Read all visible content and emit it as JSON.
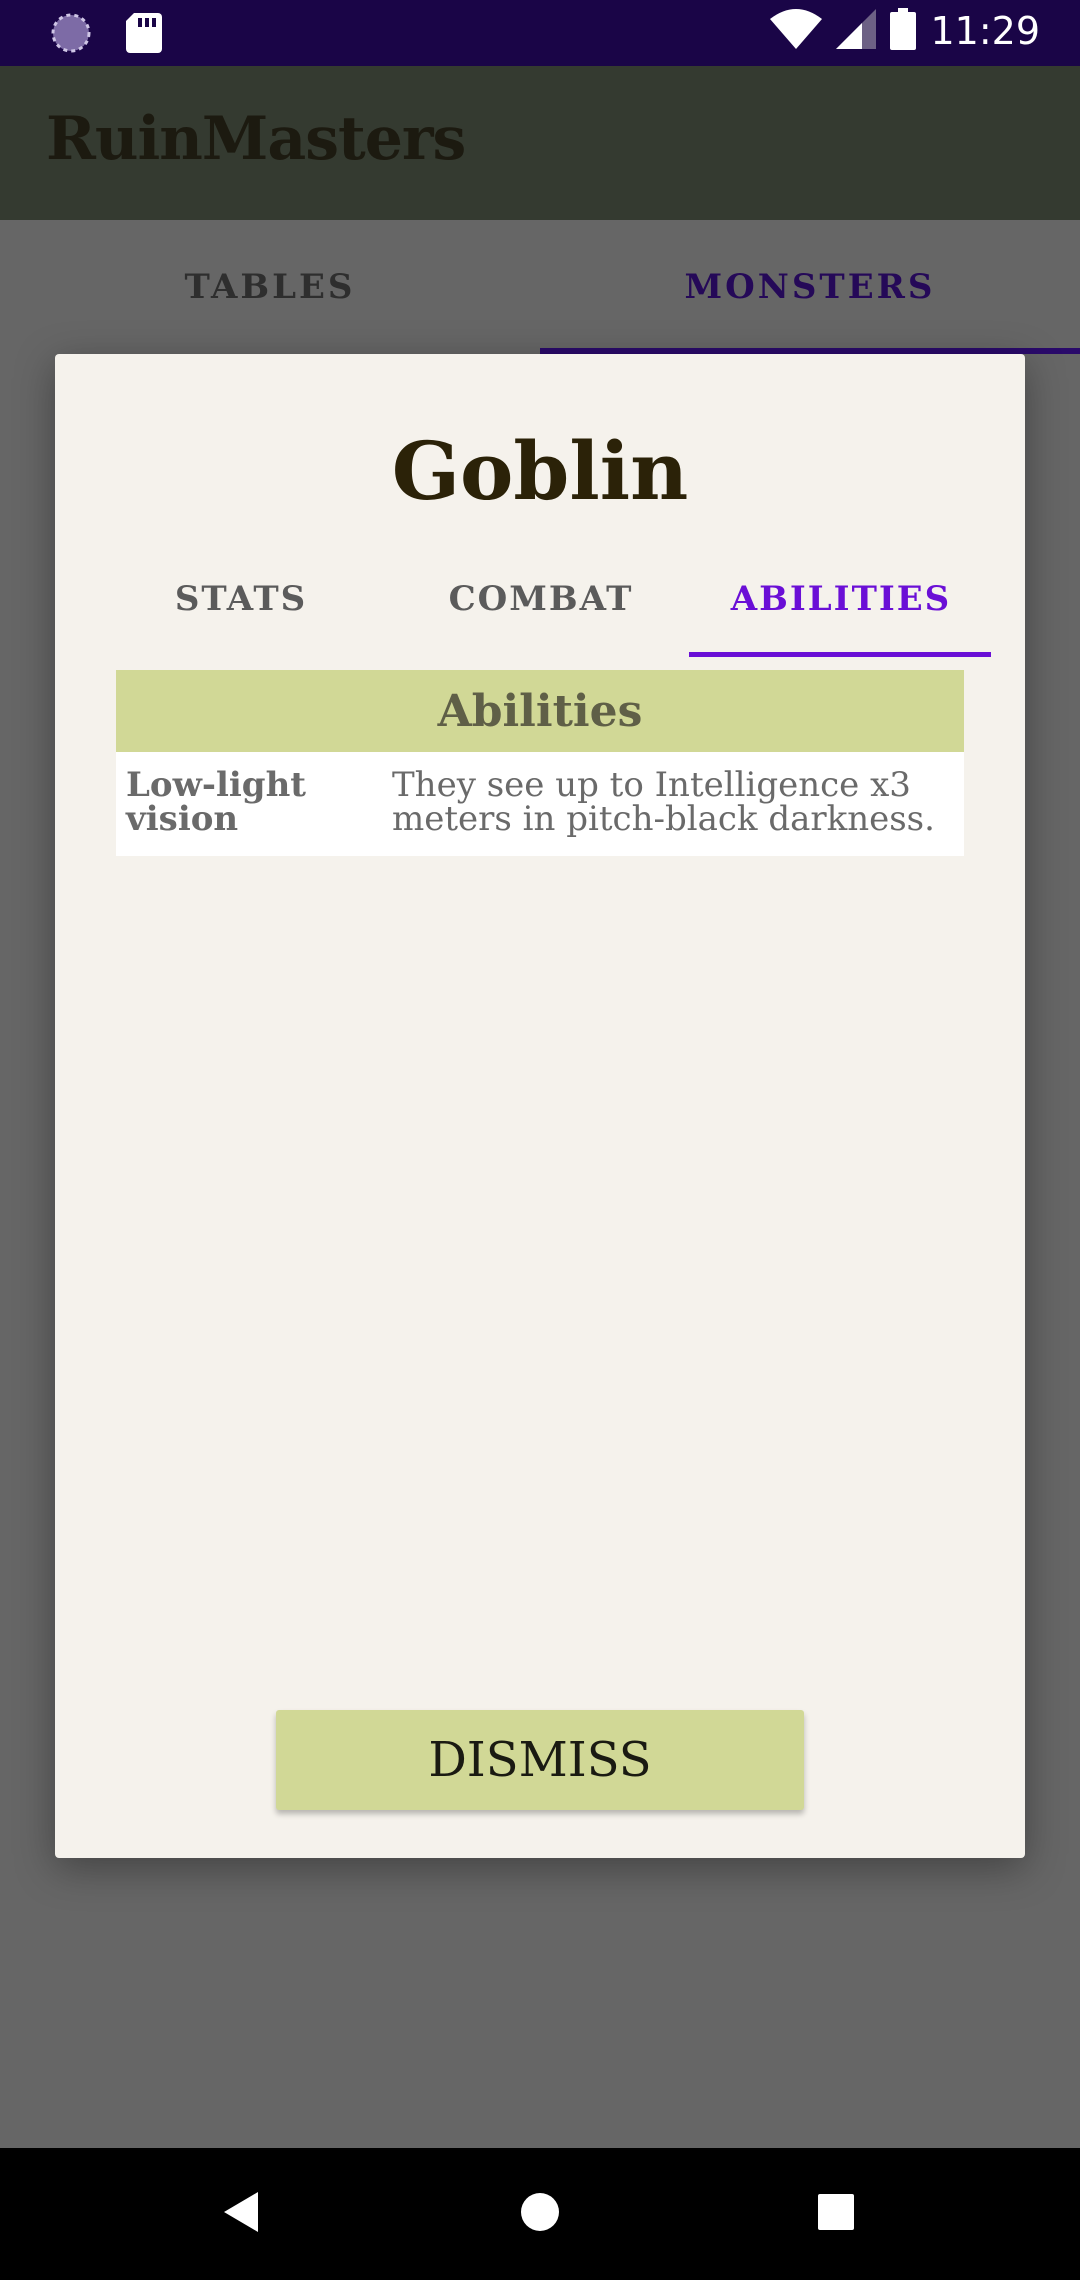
{
  "status_bar": {
    "time": "11:29",
    "icons": [
      "loading-icon",
      "sd-card-icon",
      "wifi-icon",
      "signal-icon",
      "battery-icon"
    ]
  },
  "app_bar": {
    "title": "RuinMasters"
  },
  "main_tabs": [
    {
      "label": "TABLES",
      "selected": false
    },
    {
      "label": "MONSTERS",
      "selected": true
    }
  ],
  "dialog": {
    "title": "Goblin",
    "tabs": [
      {
        "label": "STATS",
        "selected": false
      },
      {
        "label": "COMBAT",
        "selected": false
      },
      {
        "label": "ABILITIES",
        "selected": true
      }
    ],
    "abilities": {
      "header": "Abilities",
      "rows": [
        {
          "name": "Low-light vision",
          "description": "They see up to Intelligence x3 meters in pitch-black darkness."
        }
      ]
    },
    "dismiss_label": "DISMISS"
  },
  "nav_bar": {
    "icons": [
      "back-icon",
      "home-icon",
      "recents-icon"
    ]
  },
  "colors": {
    "status_bar": "#1a0547",
    "accent": "#6a0fd6",
    "header_fill": "#d1d896",
    "scrim": "#666666"
  }
}
